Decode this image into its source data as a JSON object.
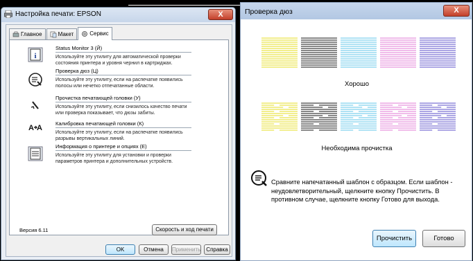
{
  "left_window": {
    "title": "Настройка печати: EPSON",
    "close_glyph": "X",
    "tabs": [
      {
        "label": "Главное",
        "icon": "main-tab-icon"
      },
      {
        "label": "Макет",
        "icon": "layout-tab-icon"
      },
      {
        "label": "Сервис",
        "icon": "service-tab-icon"
      }
    ],
    "items": [
      {
        "title": "Status Monitor 3 (Й)",
        "desc": "Используйте эту утилиту для автоматической проверки состояния принтера и уровня чернил в картриджах.",
        "icon": "status-monitor-icon"
      },
      {
        "title": "Проверка дюз (Ц)",
        "desc": "Используйте эту утилиту, если на распечатке появились полосы или нечетко отпечатанные области.",
        "icon": "nozzle-check-icon"
      },
      {
        "title": "Прочистка печатающей головки (У)",
        "desc": "Используйте эту утилиту, если снизилось качество печати или проверка показывает, что дюзы забиты.",
        "icon": "head-cleaning-icon"
      },
      {
        "title": "Калибровка печатающей головки (К)",
        "desc": "Используйте эту утилиту, если на распечатке появились разрывы вертикальных линий.",
        "icon": "head-alignment-icon"
      },
      {
        "title": "Информация о принтере и опциях (Е)",
        "desc": "Используйте эту утилиту для установки и проверки параметров принтера и дополнительных устройств.",
        "icon": "printer-info-icon"
      }
    ],
    "version": "Версия 6.11",
    "speed_button": "Скорость и ход печати",
    "buttons": {
      "ok": "OK",
      "cancel": "Отмена",
      "apply": "Применить",
      "help": "Справка"
    }
  },
  "right_window": {
    "title": "Проверка дюз",
    "close_glyph": "X",
    "good_label": "Хорошо",
    "bad_label": "Необходима прочистка",
    "message": "Сравните напечатанный шаблон с образцом. Если шаблон - неудовлетворительный, щелкните кнопку Прочистить. В противном случае, щелкните кнопку Готово для выхода.",
    "clean_button": "Прочистить",
    "done_button": "Готово",
    "pattern_colors": [
      "#e6dc1e",
      "#111111",
      "#5fc6e8",
      "#e07ad6",
      "#5a4cc8"
    ]
  }
}
